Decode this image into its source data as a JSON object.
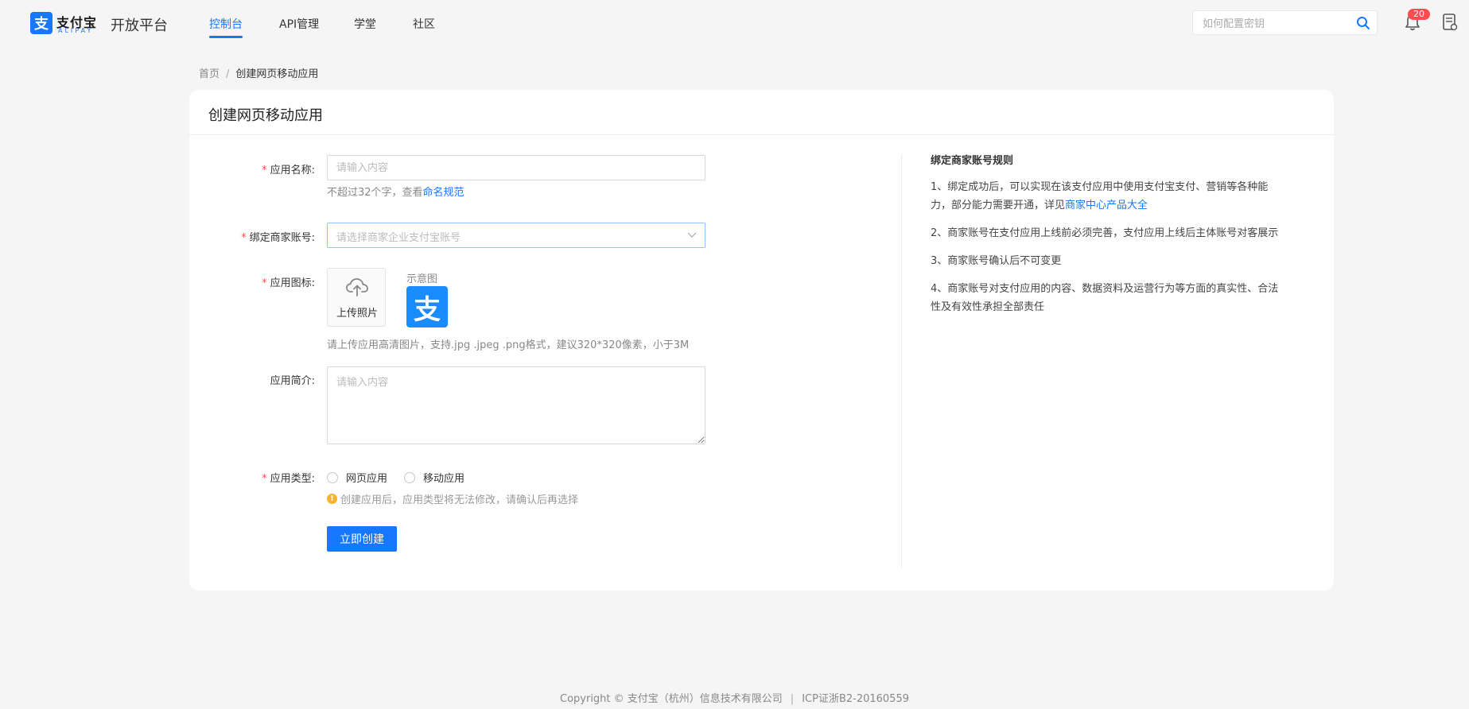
{
  "header": {
    "logo_mark": "支",
    "logo_cn": "支付宝",
    "logo_en": "ALIPAY",
    "platform_title": "开放平台",
    "tabs": [
      {
        "label": "控制台",
        "active": true
      },
      {
        "label": "API管理",
        "active": false
      },
      {
        "label": "学堂",
        "active": false
      },
      {
        "label": "社区",
        "active": false
      }
    ],
    "search_placeholder": "如何配置密钥",
    "notification_count": "20",
    "accent_color": "#1677ff"
  },
  "breadcrumb": {
    "home": "首页",
    "separator": "/",
    "current": "创建网页移动应用"
  },
  "form": {
    "title": "创建网页移动应用",
    "app_name": {
      "label": "应用名称:",
      "placeholder": "请输入内容",
      "hint": "不超过32个字，查看",
      "hint_link": "命名规范"
    },
    "merchant": {
      "label": "绑定商家账号:",
      "placeholder": "请选择商家企业支付宝账号"
    },
    "icon": {
      "label": "应用图标:",
      "upload_label": "上传照片",
      "sample_label": "示意图",
      "sample_glyph": "支",
      "hint": "请上传应用高清图片，支持.jpg .jpeg .png格式，建议320*320像素，小于3M"
    },
    "intro": {
      "label": "应用简介:",
      "placeholder": "请输入内容"
    },
    "type": {
      "label": "应用类型:",
      "options": [
        "网页应用",
        "移动应用"
      ],
      "warning": "创建应用后，应用类型将无法修改，请确认后再选择"
    },
    "submit_label": "立即创建"
  },
  "rules": {
    "title": "绑定商家账号规则",
    "items": [
      {
        "text": "1、绑定成功后，可以实现在该支付应用中使用支付宝支付、营销等各种能力，部分能力需要开通，详见",
        "link": "商家中心产品大全"
      },
      {
        "text": "2、商家账号在支付应用上线前必须完善，支付应用上线后主体账号对客展示"
      },
      {
        "text": "3、商家账号确认后不可变更"
      },
      {
        "text": "4、商家账号对支付应用的内容、数据资料及运营行为等方面的真实性、合法性及有效性承担全部责任"
      }
    ]
  },
  "footer": {
    "copyright": "Copyright © 支付宝（杭州）信息技术有限公司",
    "separator": "|",
    "icp": "ICP证浙B2-20160559"
  }
}
